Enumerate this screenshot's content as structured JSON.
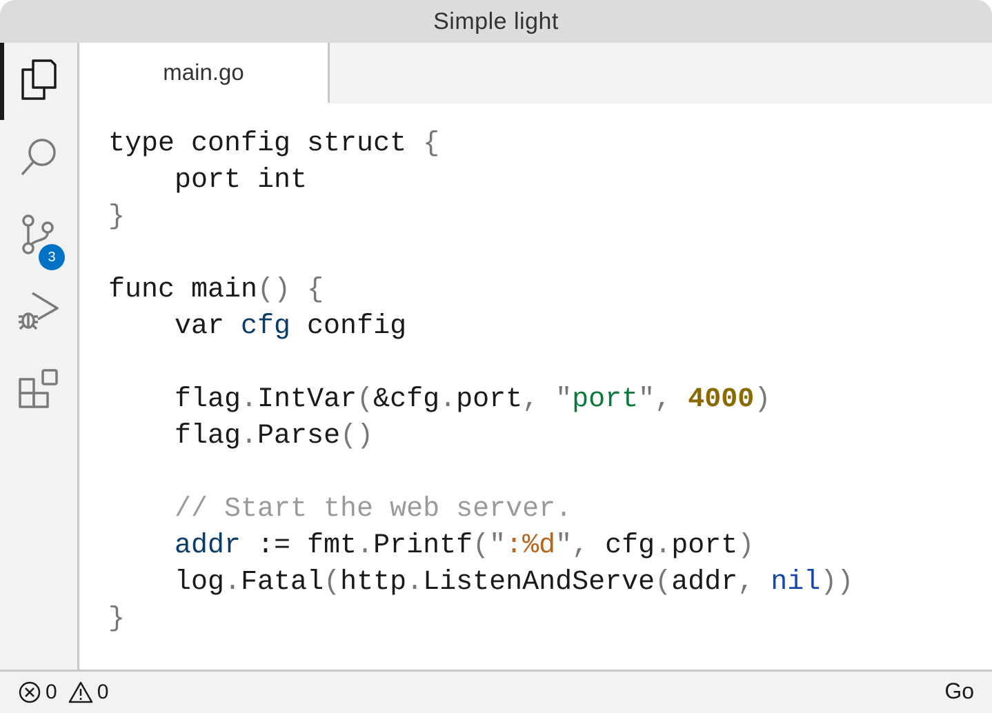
{
  "window": {
    "title": "Simple light"
  },
  "activity_bar": {
    "items": [
      {
        "name": "explorer",
        "icon": "files-icon",
        "active": true
      },
      {
        "name": "search",
        "icon": "search-icon"
      },
      {
        "name": "source-control",
        "icon": "source-control-icon",
        "badge": "3"
      },
      {
        "name": "run-debug",
        "icon": "run-debug-icon"
      },
      {
        "name": "extensions",
        "icon": "extensions-icon"
      }
    ]
  },
  "tabs": [
    {
      "label": "main.go",
      "active": true
    }
  ],
  "editor": {
    "language": "go",
    "lines": [
      "type config struct {",
      "    port int",
      "}",
      "",
      "func main() {",
      "    var cfg config",
      "",
      "    flag.IntVar(&cfg.port, \"port\", 4000)",
      "    flag.Parse()",
      "",
      "    // Start the web server.",
      "    addr := fmt.Printf(\":%d\", cfg.port)",
      "    log.Fatal(http.ListenAndServe(addr, nil))",
      "}"
    ]
  },
  "status_bar": {
    "errors": "0",
    "warnings": "0",
    "language": "Go"
  },
  "colors": {
    "punctuation": "#777777",
    "variable": "#0b3c67",
    "string": "#0a7a3c",
    "number": "#8a6a00",
    "comment": "#9a9a9a",
    "format_verb": "#b5651d",
    "keyword_nil": "#1647b0",
    "badge": "#0072c6"
  }
}
